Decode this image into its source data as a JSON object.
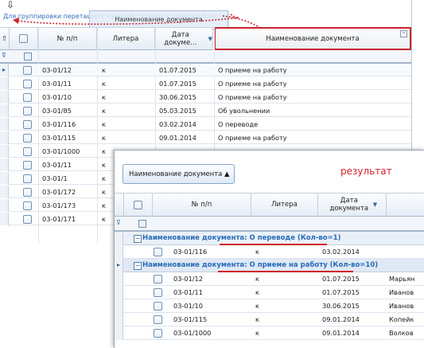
{
  "top_grid": {
    "group_hint": "Для группировки перетащите нужный столбец в данную область",
    "drag_ghost_label": "Наименование документа",
    "columns": [
      "№ п/п",
      "Литера",
      "Дата докуме...",
      "Наименование документа"
    ],
    "rows": [
      {
        "num": "03-01/12",
        "litera": "к",
        "date": "01.07.2015",
        "name": "О приеме на работу"
      },
      {
        "num": "03-01/11",
        "litera": "к",
        "date": "01.07.2015",
        "name": "О приеме на работу"
      },
      {
        "num": "03-01/10",
        "litera": "к",
        "date": "30.06.2015",
        "name": "О приеме на работу"
      },
      {
        "num": "03-01/85",
        "litera": "к",
        "date": "05.03.2015",
        "name": "Об увольнении"
      },
      {
        "num": "03-01/116",
        "litera": "к",
        "date": "03.02.2014",
        "name": "О переводе"
      },
      {
        "num": "03-01/115",
        "litera": "к",
        "date": "09.01.2014",
        "name": "О приеме на работу"
      },
      {
        "num": "03-01/1000",
        "litera": "к",
        "date": "",
        "name": ""
      },
      {
        "num": "03-01/11",
        "litera": "к",
        "date": "",
        "name": ""
      },
      {
        "num": "03-01/1",
        "litera": "к",
        "date": "",
        "name": ""
      },
      {
        "num": "03-01/172",
        "litera": "к",
        "date": "",
        "name": ""
      },
      {
        "num": "03-01/173",
        "litera": "к",
        "date": "",
        "name": ""
      },
      {
        "num": "03-01/171",
        "litera": "к",
        "date": "",
        "name": ""
      }
    ]
  },
  "result_panel": {
    "group_button_label": "Наименование документа ▲",
    "result_label": "результат",
    "columns": [
      "№ п/п",
      "Литера",
      "Дата документа"
    ],
    "groups": [
      {
        "title": "Наименование документа: О переводе (Кол-во=1)",
        "rows": [
          {
            "num": "03-01/116",
            "litera": "к",
            "date": "03.02.2014",
            "extra": ""
          }
        ]
      },
      {
        "title": "Наименование документа: О приеме на работу (Кол-во=10)",
        "rows": [
          {
            "num": "03-01/12",
            "litera": "к",
            "date": "01.07.2015",
            "extra": "Марьян"
          },
          {
            "num": "03-01/11",
            "litera": "к",
            "date": "01.07.2015",
            "extra": "Иванов"
          },
          {
            "num": "03-01/10",
            "litera": "к",
            "date": "30.06.2015",
            "extra": "Иванов"
          },
          {
            "num": "03-01/115",
            "litera": "к",
            "date": "09.01.2014",
            "extra": "Копейк"
          },
          {
            "num": "03-01/1000",
            "litera": "к",
            "date": "09.01.2014",
            "extra": "Волков"
          }
        ]
      }
    ]
  },
  "colors": {
    "accent": "#2a6cb6",
    "highlight": "#c8262c",
    "result_text": "#d1202a"
  }
}
